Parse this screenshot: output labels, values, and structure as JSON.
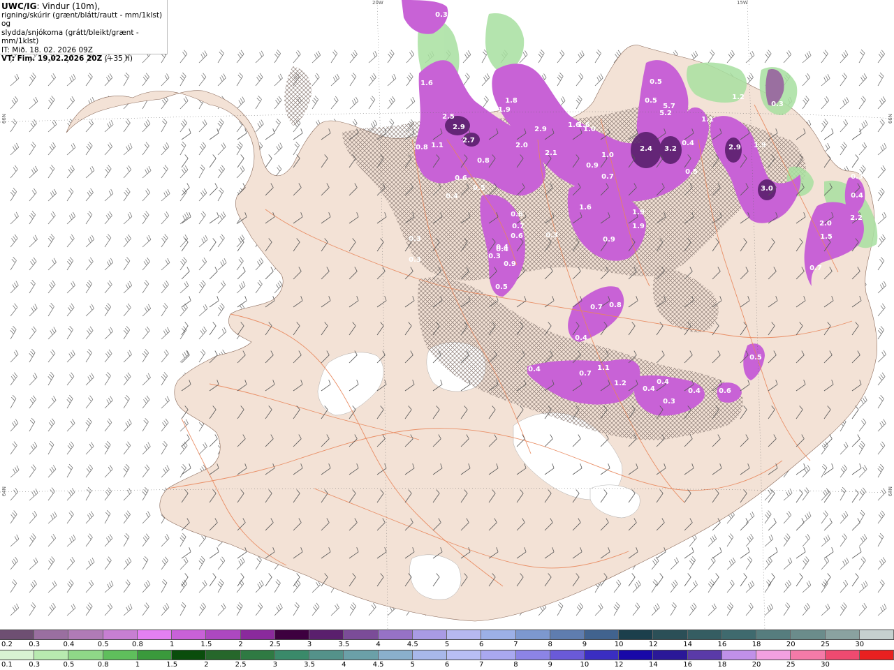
{
  "header": {
    "line1_bold": "UWC/IG",
    "line1_rest": ": Vindur (10m),",
    "line2": "rigning/skúrir (grænt/blátt/rautt - mm/1klst) og",
    "line3": "slydda/snjókoma (grátt/bleikt/grænt - mm/1klst)",
    "line4": "IT: Mið. 18. 02. 2026 09Z",
    "line5_bold": "VT: Fim. 19.02.2026 20Z",
    "line5_rest": " (+35 h)"
  },
  "coordinates": {
    "top_left": "20W",
    "top_right": "15W",
    "right_upper": "66N",
    "right_lower": "64N",
    "left_upper": "66N",
    "left_lower": "64N"
  },
  "precip_labels": [
    {
      "text": "1.6"
    },
    {
      "text": "2.5"
    },
    {
      "text": "2.9"
    },
    {
      "text": "2.7"
    },
    {
      "text": "1.1"
    },
    {
      "text": "0.8"
    },
    {
      "text": "1.8"
    },
    {
      "text": "1.9"
    },
    {
      "text": "1.6"
    },
    {
      "text": "2.0"
    },
    {
      "text": "2.9"
    },
    {
      "text": "2.1"
    },
    {
      "text": "1.6"
    },
    {
      "text": "1.0"
    },
    {
      "text": "1.0"
    },
    {
      "text": "0.9"
    },
    {
      "text": "0.7"
    },
    {
      "text": "2.4"
    },
    {
      "text": "3.2"
    },
    {
      "text": "0.5"
    },
    {
      "text": "5.7"
    },
    {
      "text": "5.2"
    },
    {
      "text": "0.5"
    },
    {
      "text": "1.1"
    },
    {
      "text": "0.4"
    },
    {
      "text": "0.5"
    },
    {
      "text": "2.9"
    },
    {
      "text": "1.9"
    },
    {
      "text": "3.0"
    },
    {
      "text": "1.2"
    },
    {
      "text": "0.2"
    },
    {
      "text": "0.3"
    },
    {
      "text": "0.8"
    },
    {
      "text": "0.5"
    },
    {
      "text": "0.4"
    },
    {
      "text": "1.6"
    },
    {
      "text": "1.9"
    },
    {
      "text": "1.9"
    },
    {
      "text": "0.9"
    },
    {
      "text": "0.3"
    },
    {
      "text": "0.4"
    },
    {
      "text": "0.6"
    },
    {
      "text": "0.7"
    },
    {
      "text": "0.6"
    },
    {
      "text": "0.4"
    },
    {
      "text": "0.3"
    },
    {
      "text": "0.9"
    },
    {
      "text": "0.5"
    },
    {
      "text": "0.7"
    },
    {
      "text": "0.8"
    },
    {
      "text": "0.4"
    },
    {
      "text": "0.4"
    },
    {
      "text": "0.7"
    },
    {
      "text": "1.1"
    },
    {
      "text": "1.2"
    },
    {
      "text": "0.4"
    },
    {
      "text": "0.4"
    },
    {
      "text": "0.3"
    },
    {
      "text": "0.4"
    },
    {
      "text": "0.6"
    },
    {
      "text": "0.5"
    },
    {
      "text": "2.0"
    },
    {
      "text": "1.5"
    },
    {
      "text": "2.2"
    },
    {
      "text": "0.7"
    },
    {
      "text": "0.6"
    },
    {
      "text": "0.3"
    },
    {
      "text": "0.3"
    },
    {
      "text": "0.3"
    },
    {
      "text": "0.3"
    },
    {
      "text": "0.4"
    }
  ],
  "legend_snow": {
    "labels": [
      "0.2",
      "0.3",
      "0.4",
      "0.5",
      "0.8",
      "1",
      "1.5",
      "2",
      "2.5",
      "3",
      "3.5",
      "4",
      "4.5",
      "5",
      "6",
      "7",
      "8",
      "9",
      "10",
      "12",
      "14",
      "16",
      "18",
      "20",
      "25",
      "30"
    ],
    "colors": [
      "#6e4f72",
      "#9a6fa0",
      "#b07bb6",
      "#c77fd2",
      "#e380f2",
      "#c861d8",
      "#ad48c0",
      "#8a2a9c",
      "#3d003f",
      "#5a1f6d",
      "#7b4c98",
      "#9672c6",
      "#a99be4",
      "#b6b8f0",
      "#9cb0e6",
      "#7d98cf",
      "#5f7daf",
      "#41638f",
      "#1b3f4c",
      "#2b4f57",
      "#355d62",
      "#3f6a6e",
      "#567d7e",
      "#6b8c8b",
      "#8aa2a0",
      "#c6d1cf"
    ]
  },
  "legend_rain": {
    "labels": [
      "0.1",
      "0.3",
      "0.5",
      "0.8",
      "1",
      "1.5",
      "2",
      "2.5",
      "3",
      "3.5",
      "4",
      "4.5",
      "5",
      "6",
      "7",
      "8",
      "9",
      "10",
      "12",
      "14",
      "16",
      "18",
      "20",
      "25",
      "30"
    ],
    "colors": [
      "#d8f3d2",
      "#b8eab0",
      "#8fd888",
      "#5fbf5c",
      "#3a9a3c",
      "#0a4d0c",
      "#26672b",
      "#2f7a43",
      "#3a8a6a",
      "#54928a",
      "#6ba0a8",
      "#8ab0cc",
      "#a8b8ea",
      "#b8bef4",
      "#a9a8f0",
      "#8c84e6",
      "#6a5ad8",
      "#3a2ec2",
      "#1808a8",
      "#2a1898",
      "#5a3aa8",
      "#c090e8",
      "#f2a0e0",
      "#f47aa8",
      "#ee4a70",
      "#e82020"
    ]
  }
}
